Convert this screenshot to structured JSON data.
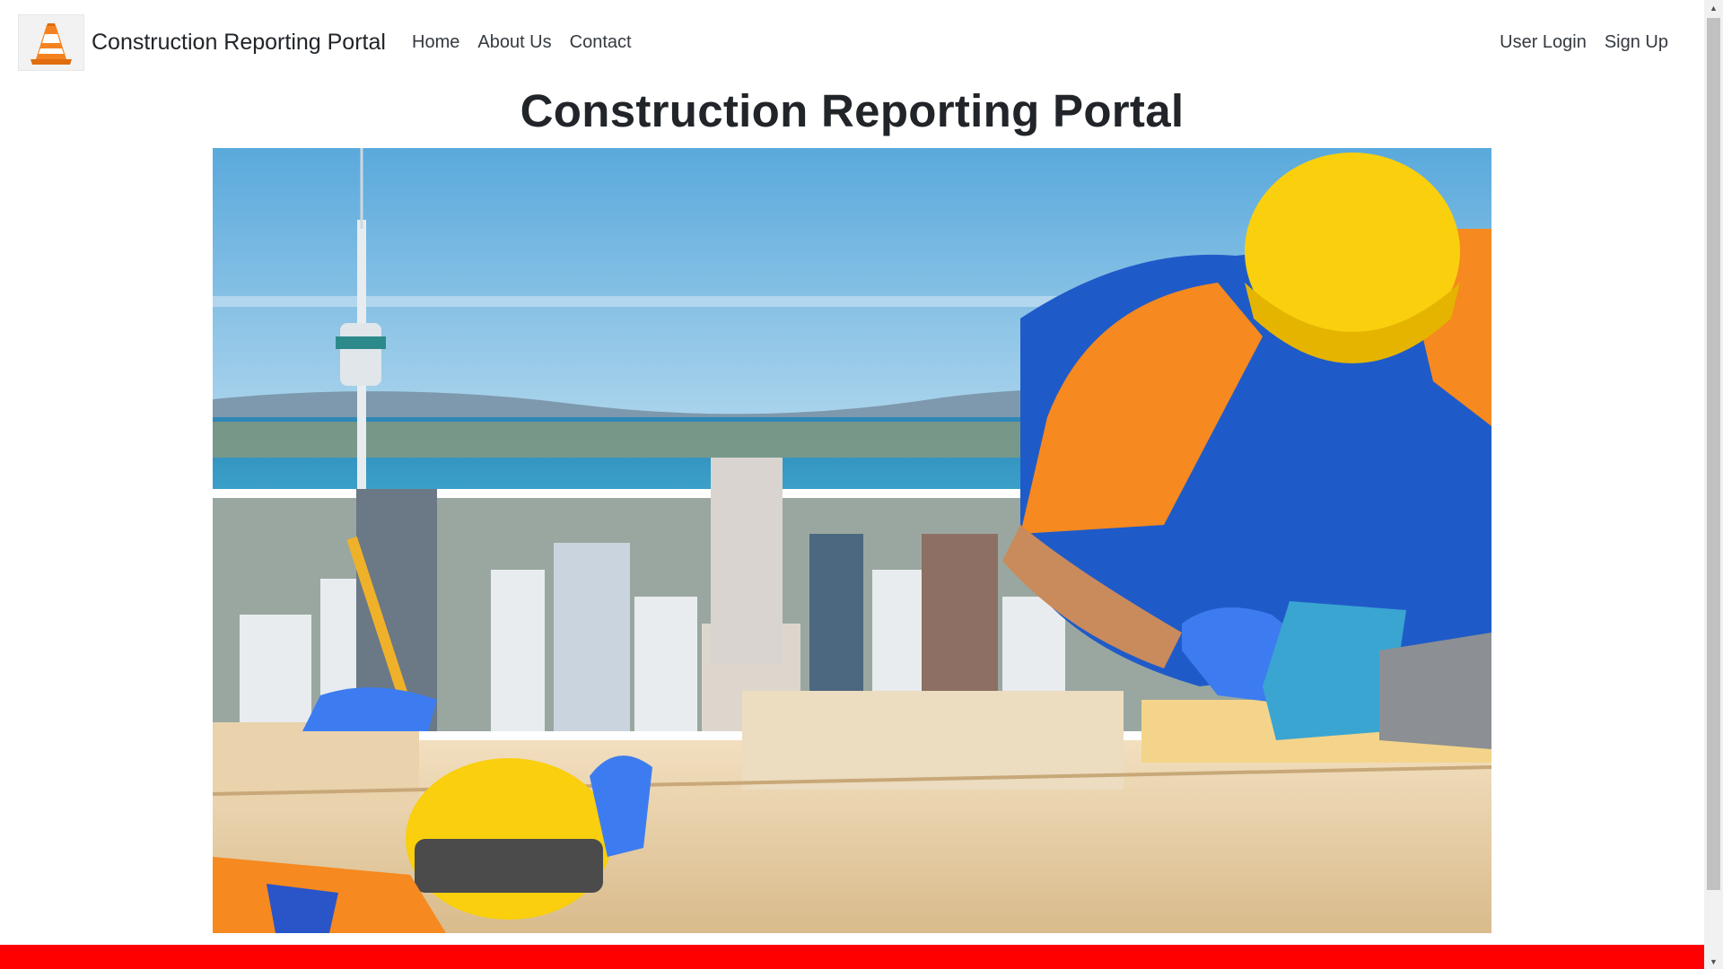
{
  "navbar": {
    "brand_name": "Construction Reporting Portal",
    "logo_icon": "traffic-cone-icon",
    "links": [
      {
        "label": "Home"
      },
      {
        "label": "About Us"
      },
      {
        "label": "Contact"
      }
    ],
    "auth": {
      "login_label": "User Login",
      "signup_label": "Sign Up"
    }
  },
  "hero": {
    "title": "Construction Reporting Portal",
    "image": "construction-workers-city-skyline"
  },
  "colors": {
    "footer_bar": "#ff0000",
    "text": "#212529"
  }
}
